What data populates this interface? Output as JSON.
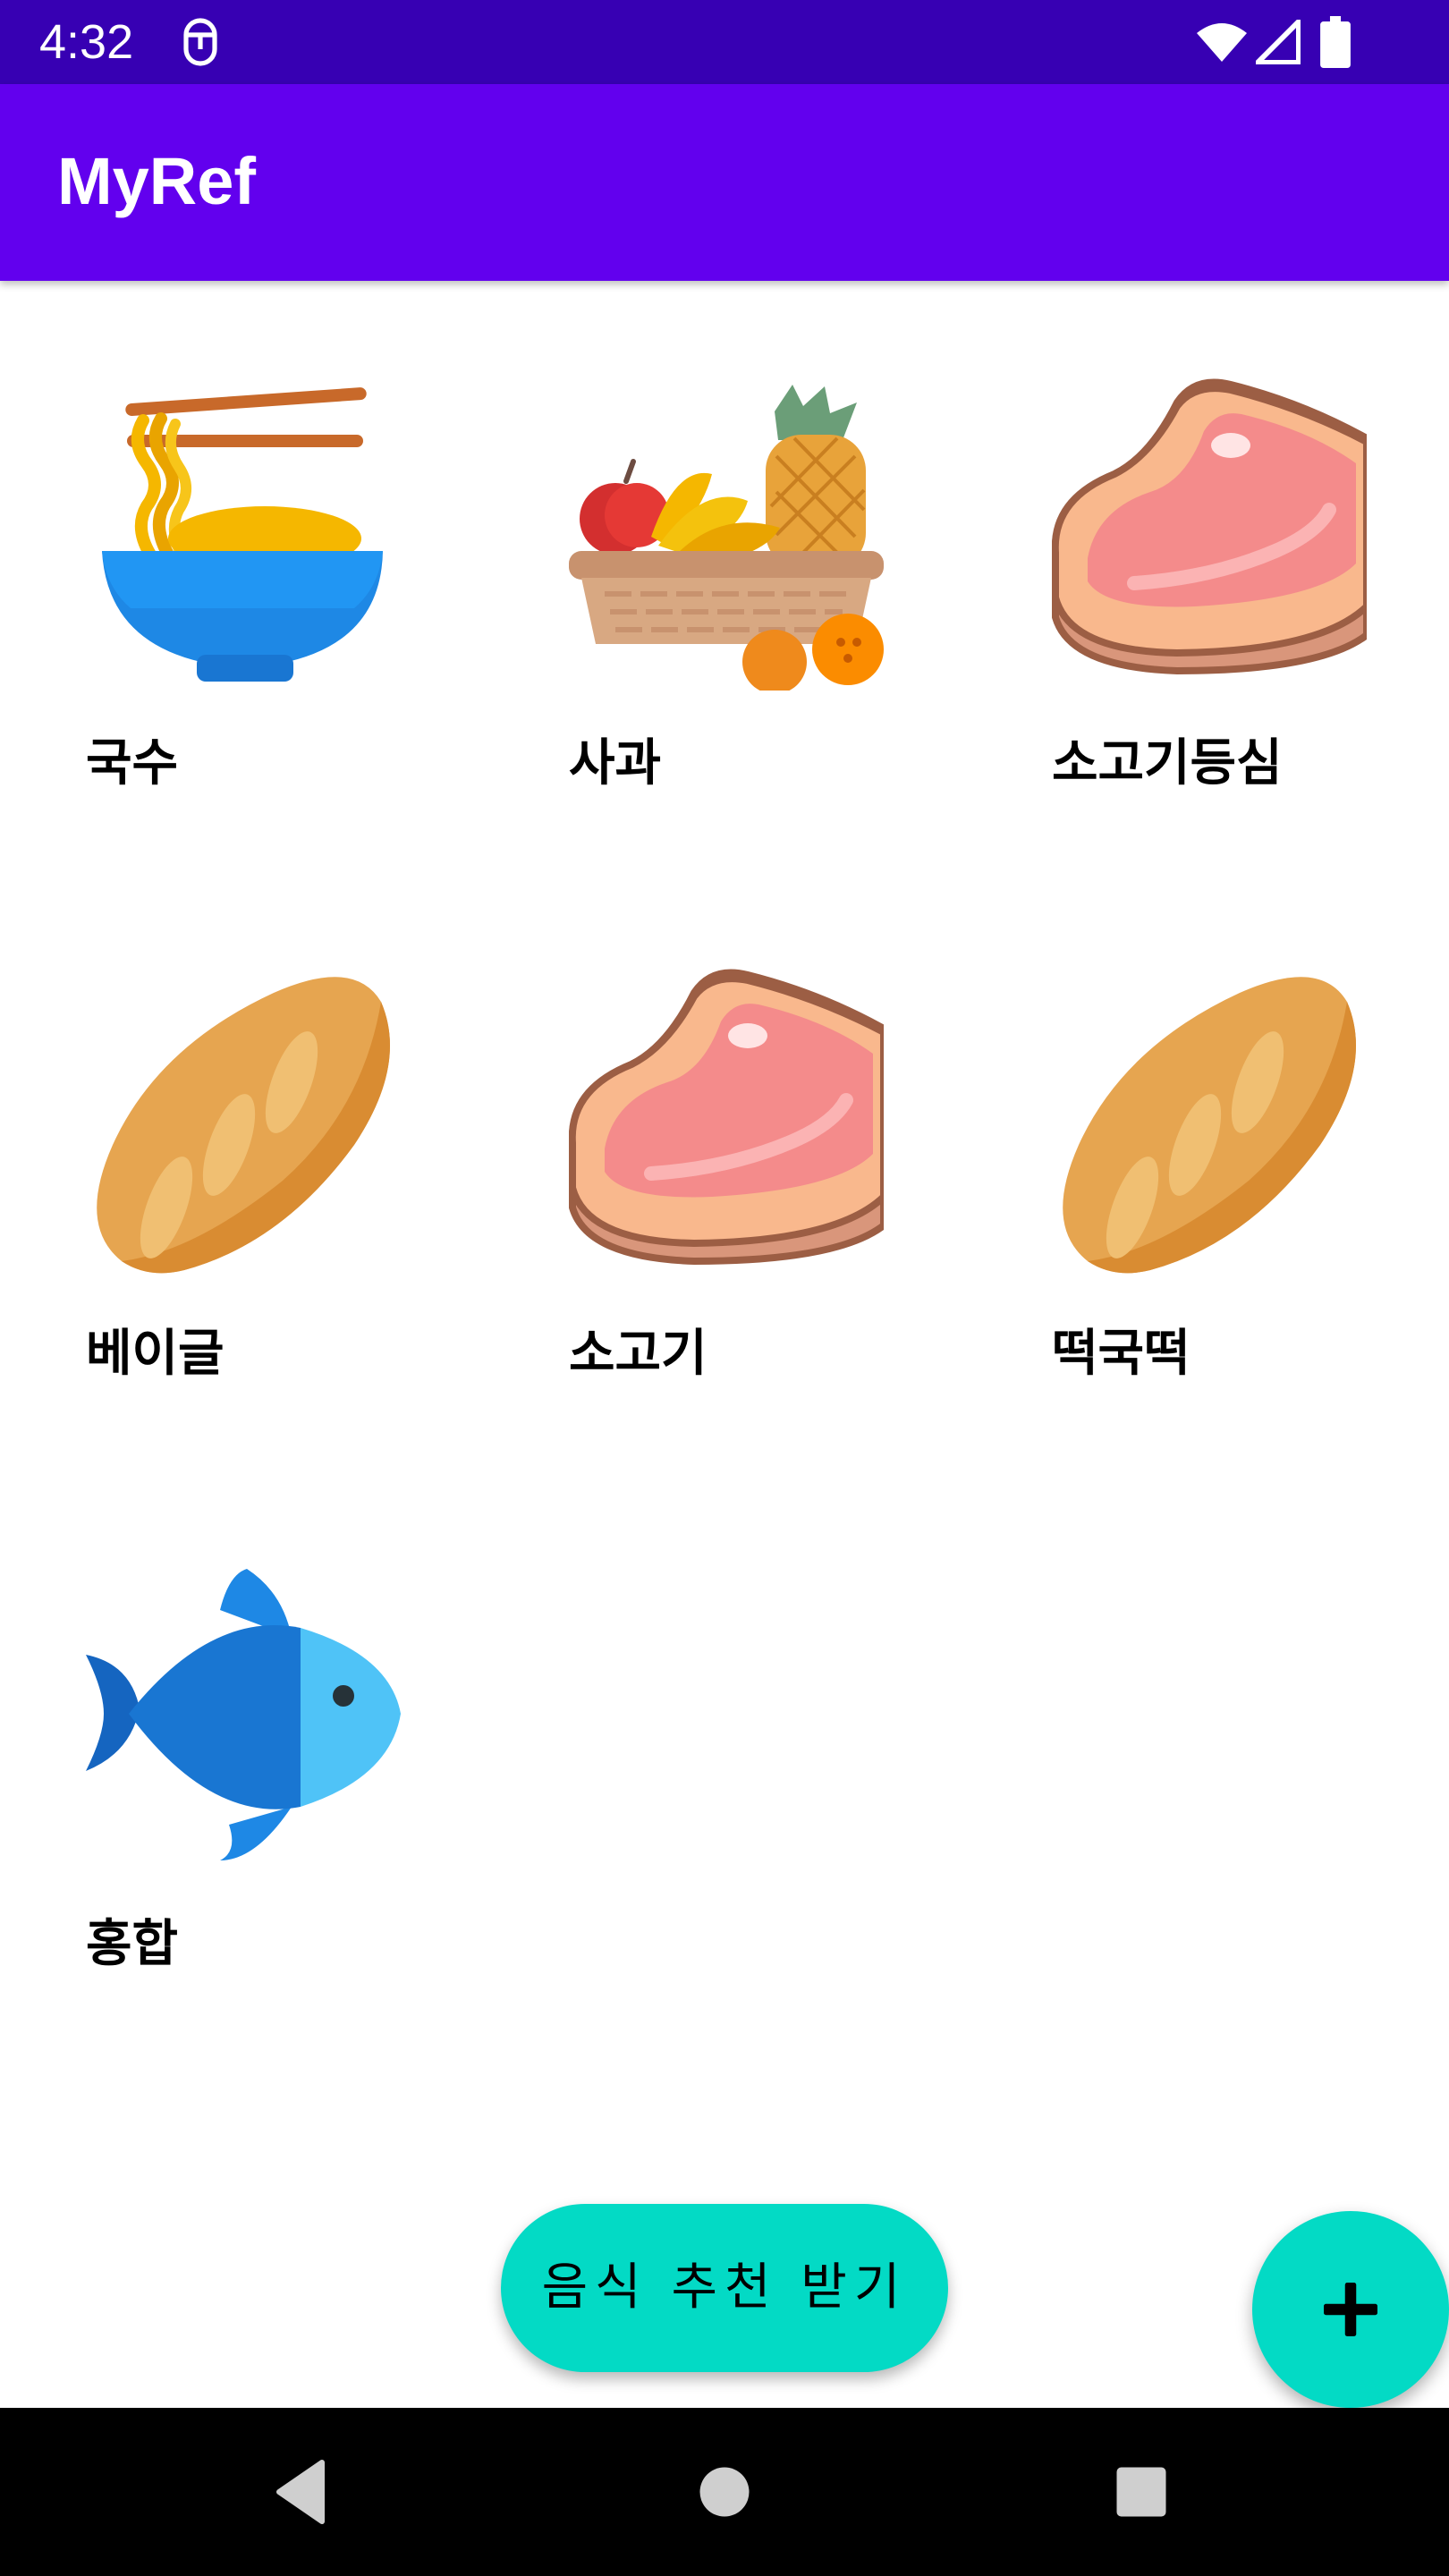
{
  "status_bar": {
    "time": "4:32",
    "icons": [
      "notification-icon",
      "wifi-icon",
      "signal-icon",
      "battery-icon"
    ]
  },
  "app_bar": {
    "title": "MyRef",
    "color": "#6200ee"
  },
  "foods": [
    {
      "label": "국수",
      "icon": "noodle-bowl-icon"
    },
    {
      "label": "사과",
      "icon": "fruit-basket-icon"
    },
    {
      "label": "소고기등심",
      "icon": "steak-icon"
    },
    {
      "label": "베이글",
      "icon": "bread-icon"
    },
    {
      "label": "소고기",
      "icon": "steak-icon"
    },
    {
      "label": "떡국떡",
      "icon": "bread-icon"
    },
    {
      "label": "홍합",
      "icon": "fish-icon"
    }
  ],
  "recommend_button": {
    "label": "음식 추천 받기",
    "color": "#03dac5"
  },
  "fab": {
    "icon": "plus-icon",
    "color": "#03dac5"
  },
  "nav_bar": {
    "icons": [
      "back-icon",
      "home-icon",
      "recents-icon"
    ]
  }
}
